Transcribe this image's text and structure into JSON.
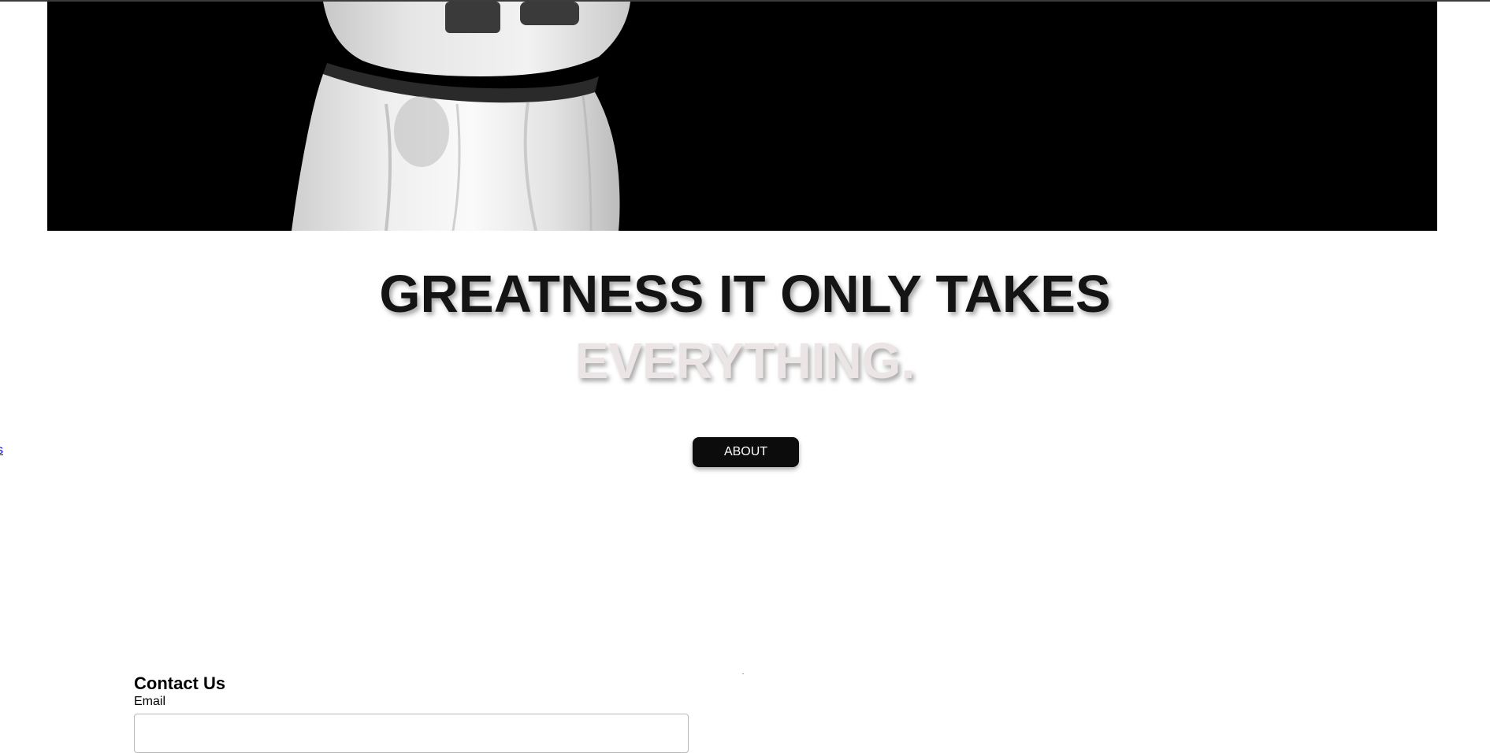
{
  "hero": {
    "image_description_icon": "basketball-player-photo-icon"
  },
  "headline": {
    "line1": "GREATNESS IT ONLY TAKES",
    "line2": "EVERYTHING."
  },
  "side_link": {
    "text": "s"
  },
  "about_button": {
    "label": "ABOUT"
  },
  "contact": {
    "title": "Contact Us",
    "email_label": "Email",
    "email_value": "",
    "email_placeholder": ""
  },
  "colors": {
    "hero_bg": "#000000",
    "headline": "#141414",
    "subheadline": "#ece5e5",
    "button_bg": "#0c0c0c",
    "button_text": "#ffffff",
    "link": "#0000ee"
  }
}
